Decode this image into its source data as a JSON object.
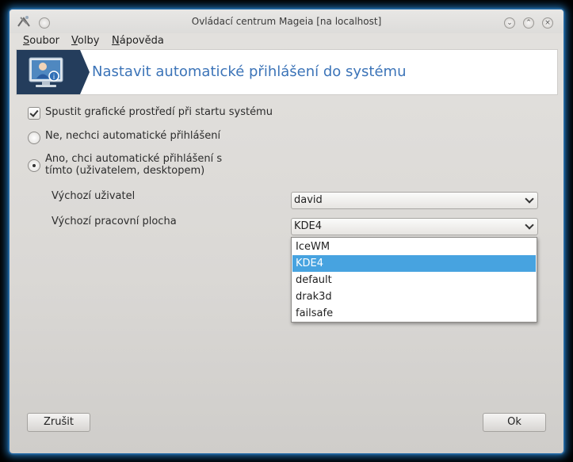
{
  "window": {
    "title": "Ovládací centrum Mageia  [na localhost]"
  },
  "menubar": [
    {
      "label": "Soubor",
      "mnemonic": "S",
      "rest": "oubor"
    },
    {
      "label": "Volby",
      "mnemonic": "V",
      "rest": "olby"
    },
    {
      "label": "Nápověda",
      "mnemonic": "N",
      "rest": "ápověda"
    }
  ],
  "header": {
    "title": "Nastavit automatické přihlášení do systému"
  },
  "options": {
    "graphical_start": {
      "label": "Spustit grafické prostředí při startu systému",
      "checked": true
    },
    "no_autologin": {
      "label": "Ne, nechci automatické přihlášení",
      "selected": false
    },
    "yes_autologin": {
      "line1": "Ano, chci automatické přihlášení s",
      "line2": "tímto (uživatelem, desktopem)",
      "selected": true
    }
  },
  "fields": {
    "default_user": {
      "label": "Výchozí uživatel",
      "value": "david"
    },
    "default_desktop": {
      "label": "Výchozí pracovní plocha",
      "value": "KDE4"
    }
  },
  "desktop_options": [
    "IceWM",
    "KDE4",
    "default",
    "drak3d",
    "failsafe"
  ],
  "selected_desktop_index": 1,
  "buttons": {
    "cancel": "Zrušit",
    "ok": "Ok"
  },
  "colors": {
    "accent": "#47a3e0",
    "header_title": "#3c74b8",
    "glow": "#1d6aa8"
  }
}
